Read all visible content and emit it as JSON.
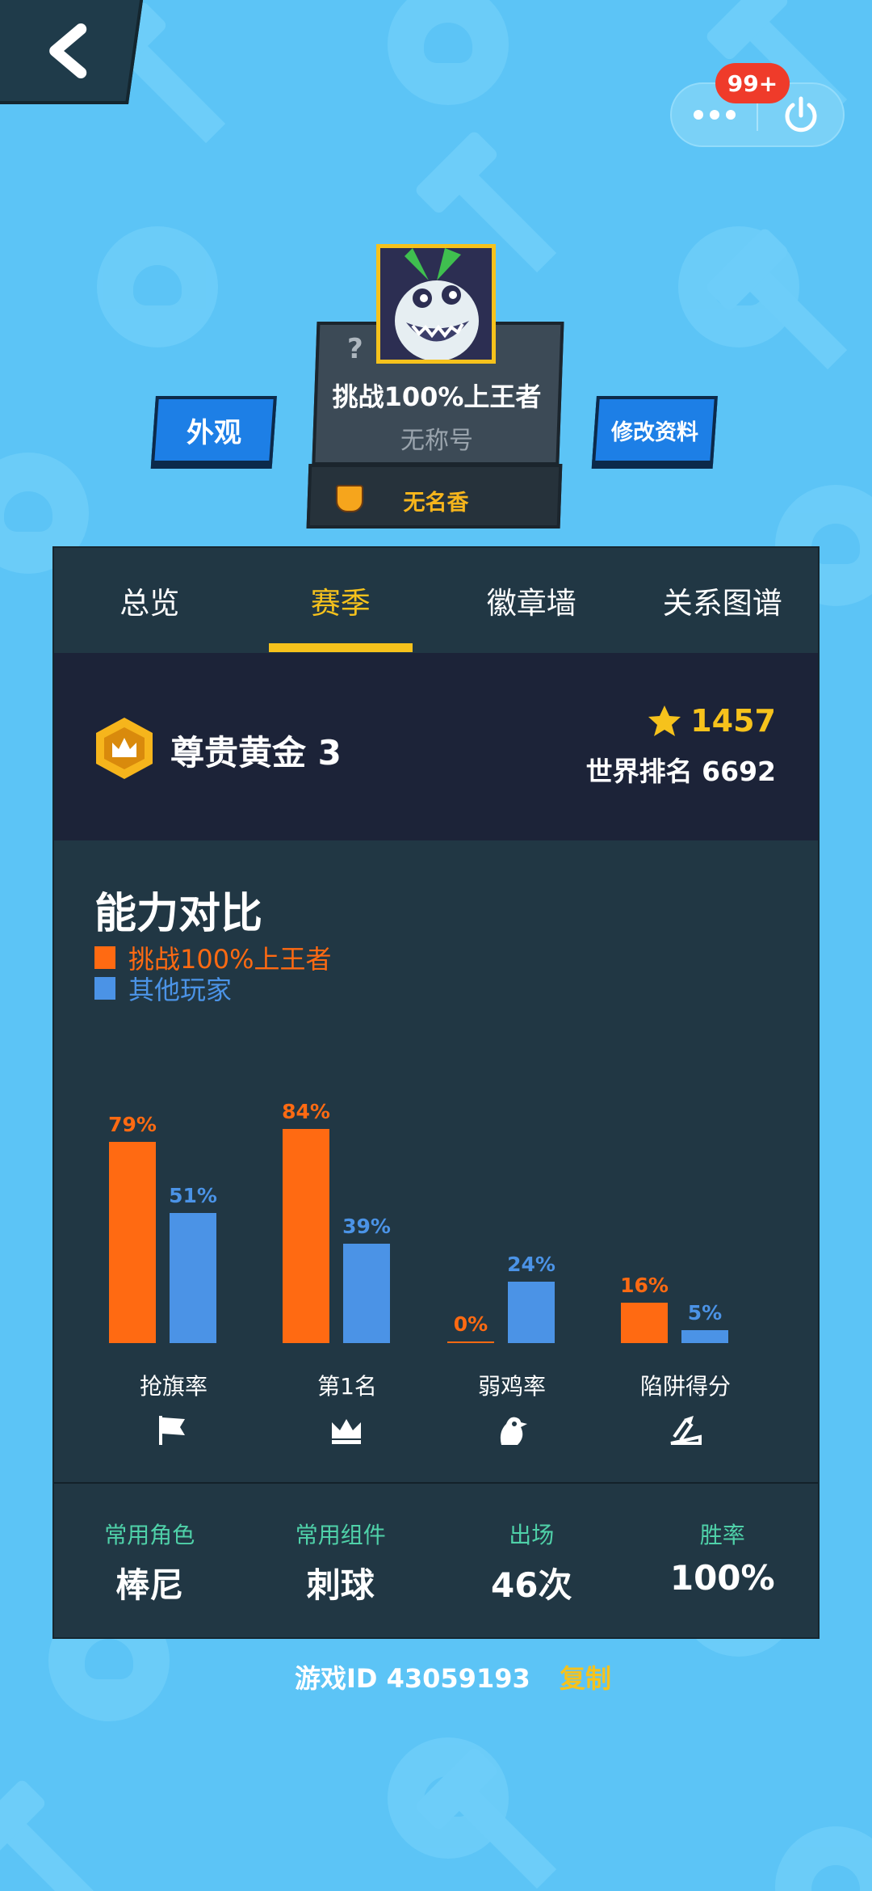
{
  "topbar": {
    "notification_count": "99+",
    "more_icon": "more-dots-icon",
    "power_icon": "power-icon"
  },
  "profile": {
    "left_button": "外观",
    "right_button": "修改资料",
    "question_mark": "?",
    "name": "挑战100%上王者",
    "title": "无称号",
    "clan": "无名香"
  },
  "tabs": [
    "总览",
    "赛季",
    "徽章墙",
    "关系图谱"
  ],
  "active_tab": 1,
  "season": {
    "rank": "尊贵黄金 3",
    "score": "1457",
    "world_rank": "世界排名 6692"
  },
  "section_title": "能力对比",
  "colors": {
    "player": "#ff6a12",
    "others": "#4b93e6",
    "accent": "#f6c21c"
  },
  "chart_data": {
    "type": "bar",
    "categories": [
      "抢旗率",
      "第1名",
      "弱鸡率",
      "陷阱得分"
    ],
    "series": [
      {
        "name": "挑战100%上王者",
        "values": [
          79,
          84,
          0,
          16
        ],
        "labels": [
          "79%",
          "84%",
          "0%",
          "16%"
        ]
      },
      {
        "name": "其他玩家",
        "values": [
          51,
          39,
          24,
          5
        ],
        "labels": [
          "51%",
          "39%",
          "24%",
          "5%"
        ]
      }
    ],
    "ylim": [
      0,
      100
    ],
    "icons": [
      "flag-icon",
      "crown-icon",
      "chicken-icon",
      "trap-icon"
    ]
  },
  "stats": [
    {
      "key": "常用角色",
      "value": "棒尼"
    },
    {
      "key": "常用组件",
      "value": "刺球"
    },
    {
      "key": "出场",
      "value": "46次"
    },
    {
      "key": "胜率",
      "value": "100%"
    }
  ],
  "footer": {
    "game_id": "游戏ID 43059193",
    "copy": "复制"
  }
}
